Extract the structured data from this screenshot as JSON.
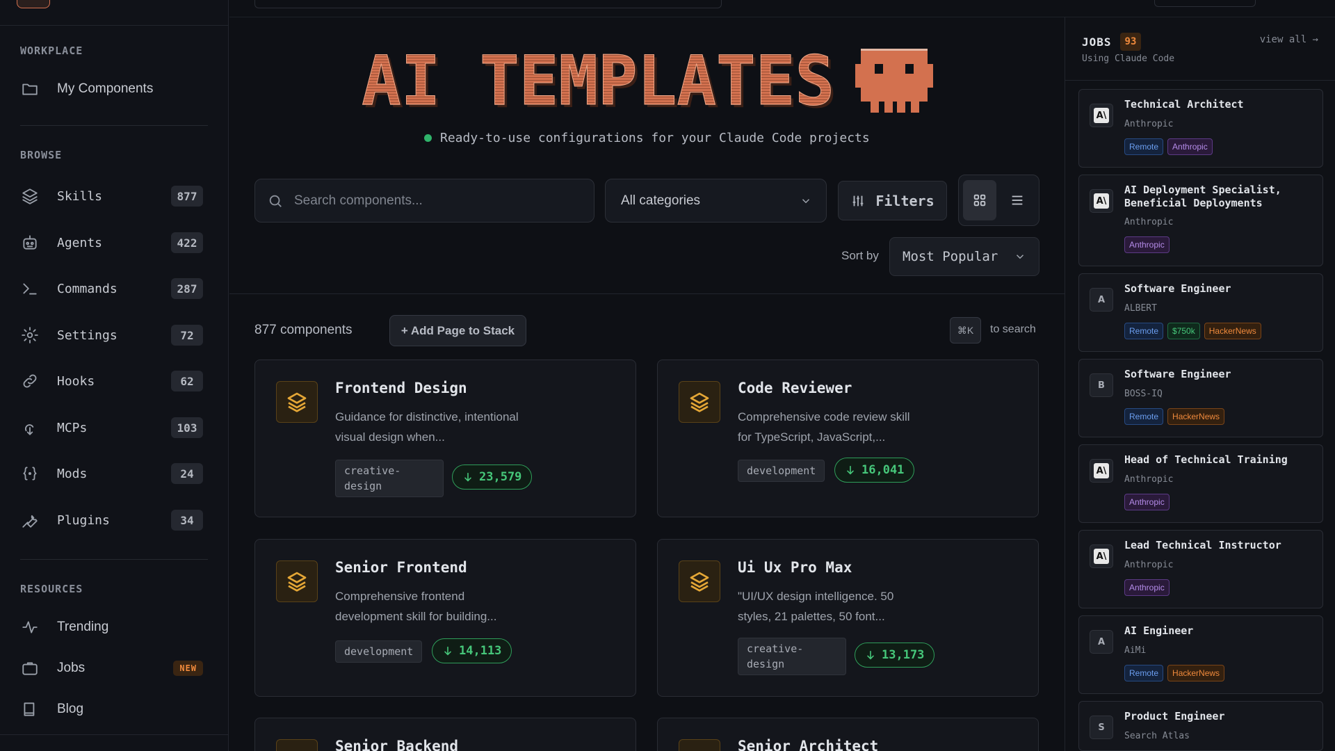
{
  "sidebar": {
    "sections": {
      "workplace": "WORKPLACE",
      "browse": "BROWSE",
      "resources": "RESOURCES"
    },
    "workplace_items": [
      {
        "label": "My Components",
        "icon": "folder-icon"
      }
    ],
    "browse_items": [
      {
        "label": "Skills",
        "count": "877",
        "icon": "layers-icon"
      },
      {
        "label": "Agents",
        "count": "422",
        "icon": "robot-icon"
      },
      {
        "label": "Commands",
        "count": "287",
        "icon": "terminal-icon"
      },
      {
        "label": "Settings",
        "count": "72",
        "icon": "gear-icon"
      },
      {
        "label": "Hooks",
        "count": "62",
        "icon": "link-icon"
      },
      {
        "label": "MCPs",
        "count": "103",
        "icon": "plug-icon"
      },
      {
        "label": "Mods",
        "count": "24",
        "icon": "braces-icon"
      },
      {
        "label": "Plugins",
        "count": "34",
        "icon": "wrench-icon"
      }
    ],
    "resource_items": [
      {
        "label": "Trending",
        "icon": "activity-icon"
      },
      {
        "label": "Jobs",
        "badge": "NEW",
        "icon": "briefcase-icon"
      },
      {
        "label": "Blog",
        "icon": "book-icon"
      }
    ]
  },
  "hero": {
    "title": "AI TEMPLATES",
    "tagline": "Ready-to-use configurations for your Claude Code projects",
    "accent_color": "#d3714f"
  },
  "controls": {
    "search_placeholder": "Search components...",
    "category": "All categories",
    "filters_label": "Filters",
    "sort_label": "Sort by",
    "sort_value": "Most Popular"
  },
  "listing": {
    "count_label": "877 components",
    "add_stack_label": "+ Add Page to Stack",
    "kbd": "⌘K",
    "kbd_hint": "to search"
  },
  "cards": [
    {
      "title": "Frontend Design",
      "desc": "Guidance for distinctive, intentional visual design when...",
      "tag": "creative-design",
      "downloads": "23,579"
    },
    {
      "title": "Code Reviewer",
      "desc": "Comprehensive code review skill for TypeScript, JavaScript,...",
      "tag": "development",
      "downloads": "16,041"
    },
    {
      "title": "Senior Frontend",
      "desc": "Comprehensive frontend development skill for building...",
      "tag": "development",
      "downloads": "14,113"
    },
    {
      "title": "Ui Ux Pro Max",
      "desc": "\"UI/UX design intelligence. 50 styles, 21 palettes, 50 font...",
      "tag": "creative-design",
      "downloads": "13,173"
    },
    {
      "title": "Senior Backend"
    },
    {
      "title": "Senior Architect"
    }
  ],
  "jobs": {
    "title": "JOBS",
    "count": "93",
    "subtitle": "Using Claude Code",
    "view_all": "view all →",
    "items": [
      {
        "title": "Technical Architect",
        "company": "Anthropic",
        "logo": "A\\",
        "tags": [
          "Remote",
          "Anthropic"
        ]
      },
      {
        "title": "AI Deployment Specialist, Beneficial Deployments",
        "company": "Anthropic",
        "logo": "A\\",
        "tags": [
          "Anthropic"
        ]
      },
      {
        "title": "Software Engineer",
        "company": "ALBERT",
        "logo": "A",
        "tags": [
          "Remote",
          "$750k",
          "HackerNews"
        ]
      },
      {
        "title": "Software Engineer",
        "company": "BOSS-IQ",
        "logo": "B",
        "tags": [
          "Remote",
          "HackerNews"
        ]
      },
      {
        "title": "Head of Technical Training",
        "company": "Anthropic",
        "logo": "A\\",
        "tags": [
          "Anthropic"
        ]
      },
      {
        "title": "Lead Technical Instructor",
        "company": "Anthropic",
        "logo": "A\\",
        "tags": [
          "Anthropic"
        ]
      },
      {
        "title": "AI Engineer",
        "company": "AiMi",
        "logo": "A",
        "tags": [
          "Remote",
          "HackerNews"
        ]
      },
      {
        "title": "Product Engineer",
        "company": "Search Atlas",
        "logo": "S",
        "tags": []
      }
    ]
  }
}
